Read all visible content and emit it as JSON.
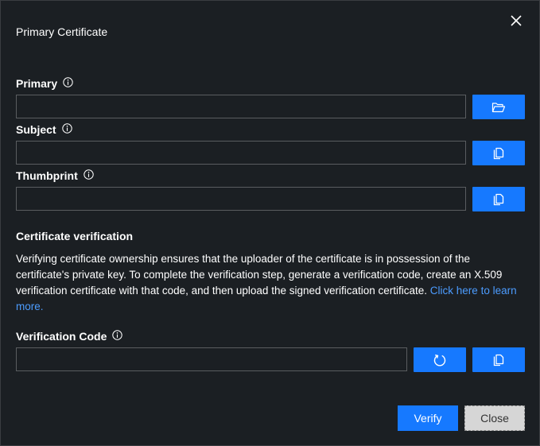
{
  "dialog": {
    "title": "Primary Certificate",
    "close_icon": "close-icon"
  },
  "fields": {
    "primary": {
      "label": "Primary",
      "value": "",
      "placeholder": "",
      "action_icon": "folder-open-icon"
    },
    "subject": {
      "label": "Subject",
      "value": "",
      "placeholder": "",
      "action_icon": "copy-icon"
    },
    "thumbprint": {
      "label": "Thumbprint",
      "value": "",
      "placeholder": "",
      "action_icon": "copy-icon"
    }
  },
  "verification": {
    "heading": "Certificate verification",
    "description": "Verifying certificate ownership ensures that the uploader of the certificate is in possession of the certificate's private key. To complete the verification step, generate a verification code, create an X.509 verification certificate with that code, and then upload the signed verification certificate. ",
    "link_text": "Click here to learn more.",
    "code": {
      "label": "Verification Code",
      "value": "",
      "placeholder": "",
      "refresh_icon": "refresh-icon",
      "copy_icon": "copy-icon"
    }
  },
  "footer": {
    "verify_label": "Verify",
    "close_label": "Close"
  },
  "colors": {
    "background": "#1b1f23",
    "accent": "#1679ff",
    "link": "#4c9cff",
    "input_border": "#5a5d60",
    "secondary_button": "#d6d6d6"
  }
}
